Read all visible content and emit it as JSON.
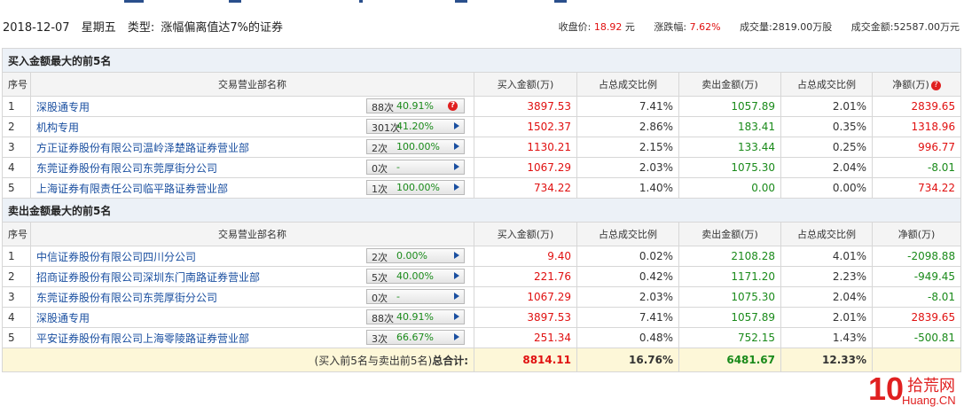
{
  "header": {
    "date": "2018-12-07",
    "weekday": "星期五",
    "type_label": "类型:",
    "type_value": "涨幅偏离值达7%的证券",
    "close_label": "收盘价:",
    "close_value": "18.92",
    "close_unit": "元",
    "change_label": "涨跌幅:",
    "change_value": "7.62%",
    "volume_label": "成交量:",
    "volume_value": "2819.00万股",
    "amount_label": "成交金额:",
    "amount_value": "52587.00万元"
  },
  "buy_section": {
    "title": "买入金额最大的前5名",
    "columns": [
      "序号",
      "交易营业部名称",
      "买入金额(万)",
      "占总成交比例",
      "卖出金额(万)",
      "占总成交比例",
      "净额(万)"
    ],
    "rows": [
      {
        "idx": "1",
        "name": "深股通专用",
        "count": "88次",
        "pct": "40.91%",
        "icon": "question-icon",
        "buy": "3897.53",
        "buy_ratio": "7.41%",
        "sell": "1057.89",
        "sell_ratio": "2.01%",
        "net": "2839.65",
        "net_color": "red"
      },
      {
        "idx": "2",
        "name": "机构专用",
        "count": "301次",
        "pct": "41.20%",
        "icon": "arrow-right-icon",
        "buy": "1502.37",
        "buy_ratio": "2.86%",
        "sell": "183.41",
        "sell_ratio": "0.35%",
        "net": "1318.96",
        "net_color": "red"
      },
      {
        "idx": "3",
        "name": "方正证券股份有限公司温岭泽楚路证券营业部",
        "count": "2次",
        "pct": "100.00%",
        "icon": "arrow-right-icon",
        "buy": "1130.21",
        "buy_ratio": "2.15%",
        "sell": "133.44",
        "sell_ratio": "0.25%",
        "net": "996.77",
        "net_color": "red"
      },
      {
        "idx": "4",
        "name": "东莞证券股份有限公司东莞厚街分公司",
        "count": "0次",
        "pct": "-",
        "icon": "arrow-right-icon",
        "buy": "1067.29",
        "buy_ratio": "2.03%",
        "sell": "1075.30",
        "sell_ratio": "2.04%",
        "net": "-8.01",
        "net_color": "green"
      },
      {
        "idx": "5",
        "name": "上海证券有限责任公司临平路证券营业部",
        "count": "1次",
        "pct": "100.00%",
        "icon": "arrow-right-icon",
        "buy": "734.22",
        "buy_ratio": "1.40%",
        "sell": "0.00",
        "sell_ratio": "0.00%",
        "net": "734.22",
        "net_color": "red"
      }
    ]
  },
  "sell_section": {
    "title": "卖出金额最大的前5名",
    "columns": [
      "序号",
      "交易营业部名称",
      "买入金额(万)",
      "占总成交比例",
      "卖出金额(万)",
      "占总成交比例",
      "净额(万)"
    ],
    "rows": [
      {
        "idx": "1",
        "name": "中信证券股份有限公司四川分公司",
        "count": "2次",
        "pct": "0.00%",
        "icon": "arrow-right-icon",
        "buy": "9.40",
        "buy_ratio": "0.02%",
        "sell": "2108.28",
        "sell_ratio": "4.01%",
        "net": "-2098.88",
        "net_color": "green"
      },
      {
        "idx": "2",
        "name": "招商证券股份有限公司深圳东门南路证券营业部",
        "count": "5次",
        "pct": "40.00%",
        "icon": "arrow-right-icon",
        "buy": "221.76",
        "buy_ratio": "0.42%",
        "sell": "1171.20",
        "sell_ratio": "2.23%",
        "net": "-949.45",
        "net_color": "green"
      },
      {
        "idx": "3",
        "name": "东莞证券股份有限公司东莞厚街分公司",
        "count": "0次",
        "pct": "-",
        "icon": "arrow-right-icon",
        "buy": "1067.29",
        "buy_ratio": "2.03%",
        "sell": "1075.30",
        "sell_ratio": "2.04%",
        "net": "-8.01",
        "net_color": "green"
      },
      {
        "idx": "4",
        "name": "深股通专用",
        "count": "88次",
        "pct": "40.91%",
        "icon": "arrow-right-icon",
        "buy": "3897.53",
        "buy_ratio": "7.41%",
        "sell": "1057.89",
        "sell_ratio": "2.01%",
        "net": "2839.65",
        "net_color": "red"
      },
      {
        "idx": "5",
        "name": "平安证券股份有限公司上海零陵路证券营业部",
        "count": "3次",
        "pct": "66.67%",
        "icon": "arrow-right-icon",
        "buy": "251.34",
        "buy_ratio": "0.48%",
        "sell": "752.15",
        "sell_ratio": "1.43%",
        "net": "-500.81",
        "net_color": "green"
      }
    ]
  },
  "total": {
    "label_prefix": "(买入前5名与卖出前5名)",
    "label_bold": "总合计:",
    "buy": "8814.11",
    "buy_ratio": "16.76%",
    "sell": "6481.67",
    "sell_ratio": "12.33%"
  },
  "watermark": {
    "logo_number": "10",
    "logo_text": "拾荒网",
    "logo_domain": "Huang.CN"
  },
  "colors": {
    "red": "#e01010",
    "green": "#1a8a1a",
    "link": "#1a4fa0",
    "section_bg": "#ecf1f7",
    "total_bg": "#fdf7d8"
  }
}
